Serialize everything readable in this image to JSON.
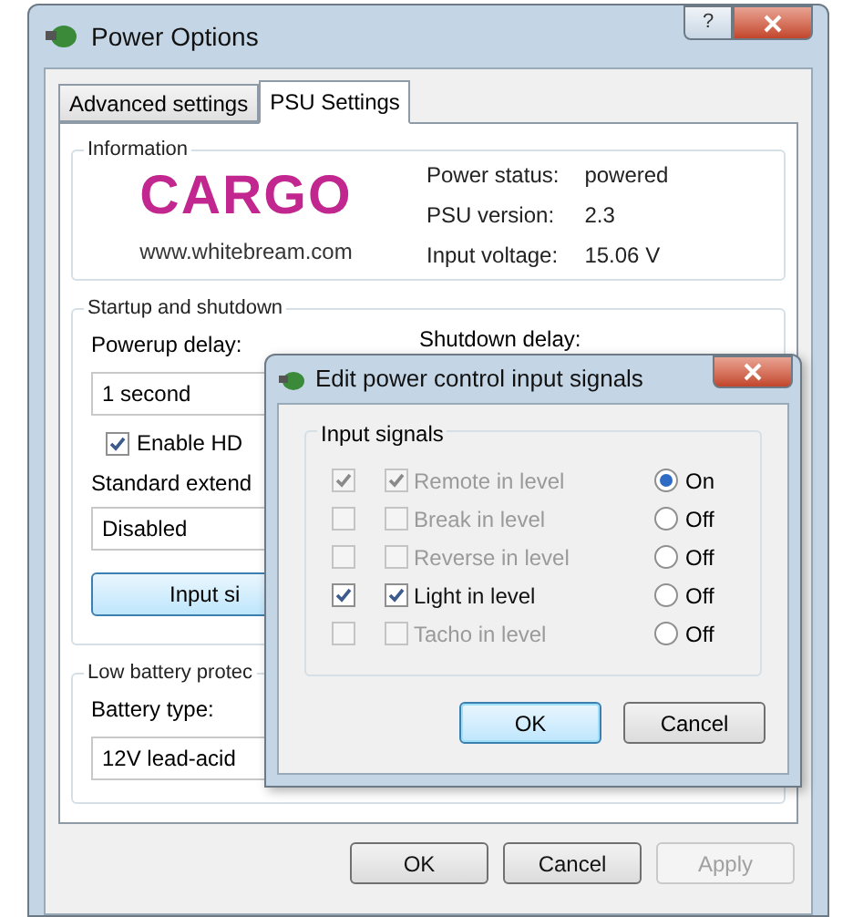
{
  "window": {
    "title": "Power Options",
    "help": "?"
  },
  "tabs": [
    {
      "label": "Advanced settings",
      "selected": false
    },
    {
      "label": "PSU Settings",
      "selected": true
    }
  ],
  "information": {
    "title": "Information",
    "logo": "CARGO",
    "url": "www.whitebream.com",
    "fields": [
      {
        "label": "Power status:",
        "value": "powered"
      },
      {
        "label": "PSU version:",
        "value": "2.3"
      },
      {
        "label": "Input voltage:",
        "value": "15.06 V"
      }
    ]
  },
  "startup": {
    "title": "Startup and shutdown",
    "powerup_label": "Powerup delay:",
    "powerup_value": "1 second",
    "shutdown_label": "Shutdown delay:",
    "hd_checkbox": {
      "label": "Enable HD",
      "checked": true
    },
    "standard_label": "Standard extend",
    "standard_value": "Disabled",
    "input_button": "Input si"
  },
  "battery": {
    "title": "Low battery protec",
    "type_label": "Battery type:",
    "type_value": "12V lead-acid"
  },
  "buttons": [
    {
      "label": "OK",
      "disabled": false
    },
    {
      "label": "Cancel",
      "disabled": false
    },
    {
      "label": "Apply",
      "disabled": true
    }
  ],
  "dialog": {
    "title": "Edit power control input signals",
    "group": "Input signals",
    "rows": [
      {
        "checked": true,
        "disabled": true,
        "label": "Remote in level",
        "level_checked": true,
        "option": "On",
        "selected": true
      },
      {
        "checked": false,
        "disabled": true,
        "label": "Break in level",
        "level_checked": false,
        "option": "Off",
        "selected": false
      },
      {
        "checked": false,
        "disabled": true,
        "label": "Reverse in level",
        "level_checked": false,
        "option": "Off",
        "selected": false
      },
      {
        "checked": true,
        "disabled": false,
        "label": "Light in level",
        "level_checked": true,
        "option": "Off",
        "selected": false
      },
      {
        "checked": false,
        "disabled": true,
        "label": "Tacho in level",
        "level_checked": false,
        "option": "Off",
        "selected": false
      }
    ],
    "buttons": [
      {
        "label": "OK",
        "default": true
      },
      {
        "label": "Cancel",
        "default": false
      }
    ]
  }
}
